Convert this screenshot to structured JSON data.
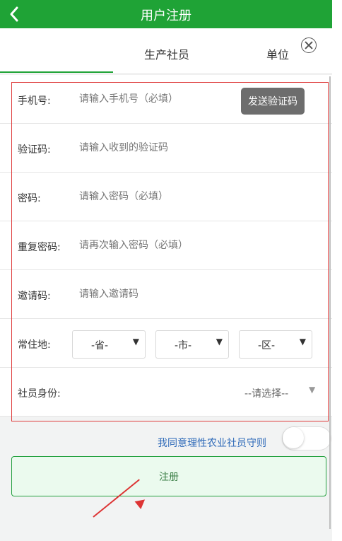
{
  "header": {
    "title": "用户注册"
  },
  "tabs": [
    {
      "label": ""
    },
    {
      "label": "生产社员"
    },
    {
      "label": "单位"
    }
  ],
  "form": {
    "phone": {
      "label": "手机号:",
      "placeholder": "请输入手机号（必填）",
      "button": "发送验证码"
    },
    "code": {
      "label": "验证码:",
      "placeholder": "请输入收到的验证码"
    },
    "password": {
      "label": "密码:",
      "placeholder": "请输入密码（必填）"
    },
    "repeat_password": {
      "label": "重复密码:",
      "placeholder": "请再次输入密码（必填）"
    },
    "invite_code": {
      "label": "邀请码:",
      "placeholder": "请输入邀请码"
    },
    "residence": {
      "label": "常住地:",
      "province": "-省-",
      "city": "-市-",
      "district": "-区-"
    },
    "identity": {
      "label": "社员身份:",
      "value": "--请选择--"
    }
  },
  "agreement": {
    "text": "我同意理性农业社员守则"
  },
  "register": {
    "label": "注册"
  }
}
